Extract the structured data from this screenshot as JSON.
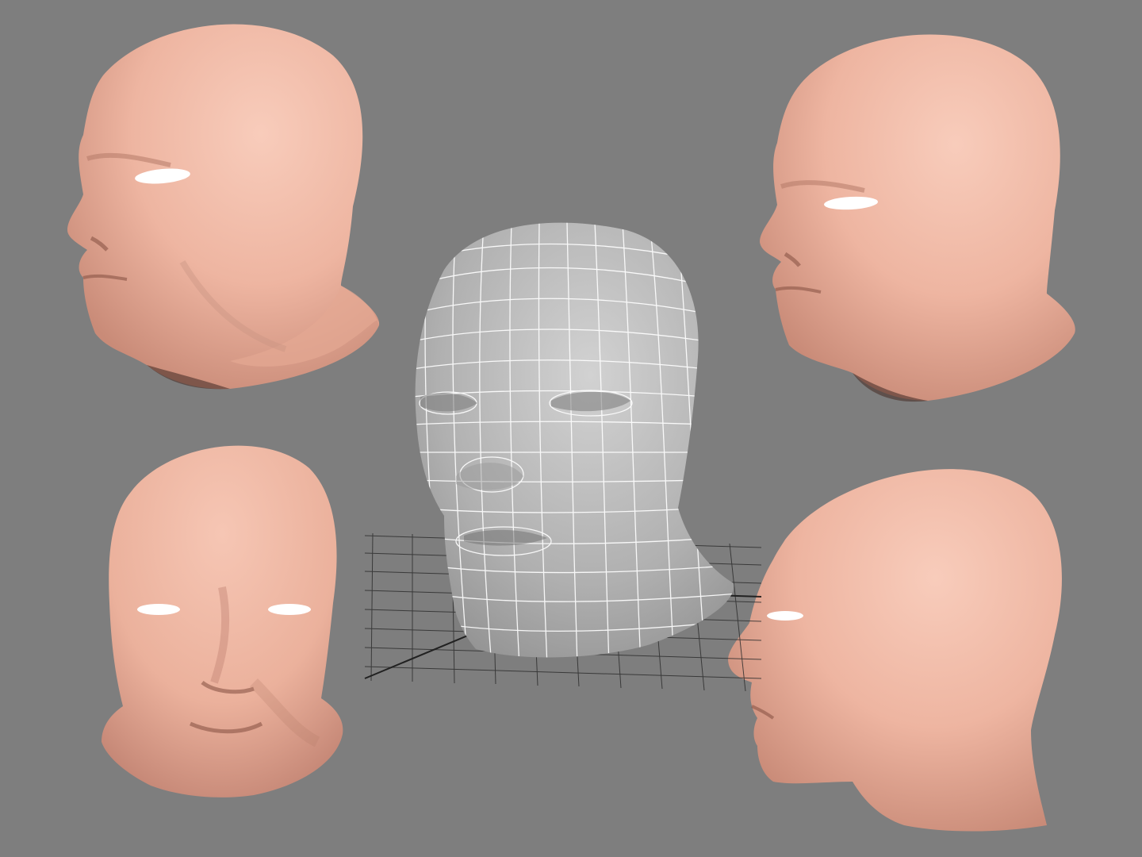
{
  "scene": {
    "background_color": "#7e7e7e",
    "skin_color": "#f0b8a4",
    "skin_shadow_color": "#8a5a4c",
    "wireframe_mesh_color": "#b4b4b4",
    "wireframe_line_color": "#ffffff",
    "grid_color": "#2a2a2a",
    "views": [
      {
        "name": "three-quarter-left",
        "render": "shaded"
      },
      {
        "name": "three-quarter-left-lowered",
        "render": "shaded"
      },
      {
        "name": "front",
        "render": "shaded"
      },
      {
        "name": "profile-left",
        "render": "shaded"
      },
      {
        "name": "front-wireframe",
        "render": "wireframe"
      }
    ]
  }
}
